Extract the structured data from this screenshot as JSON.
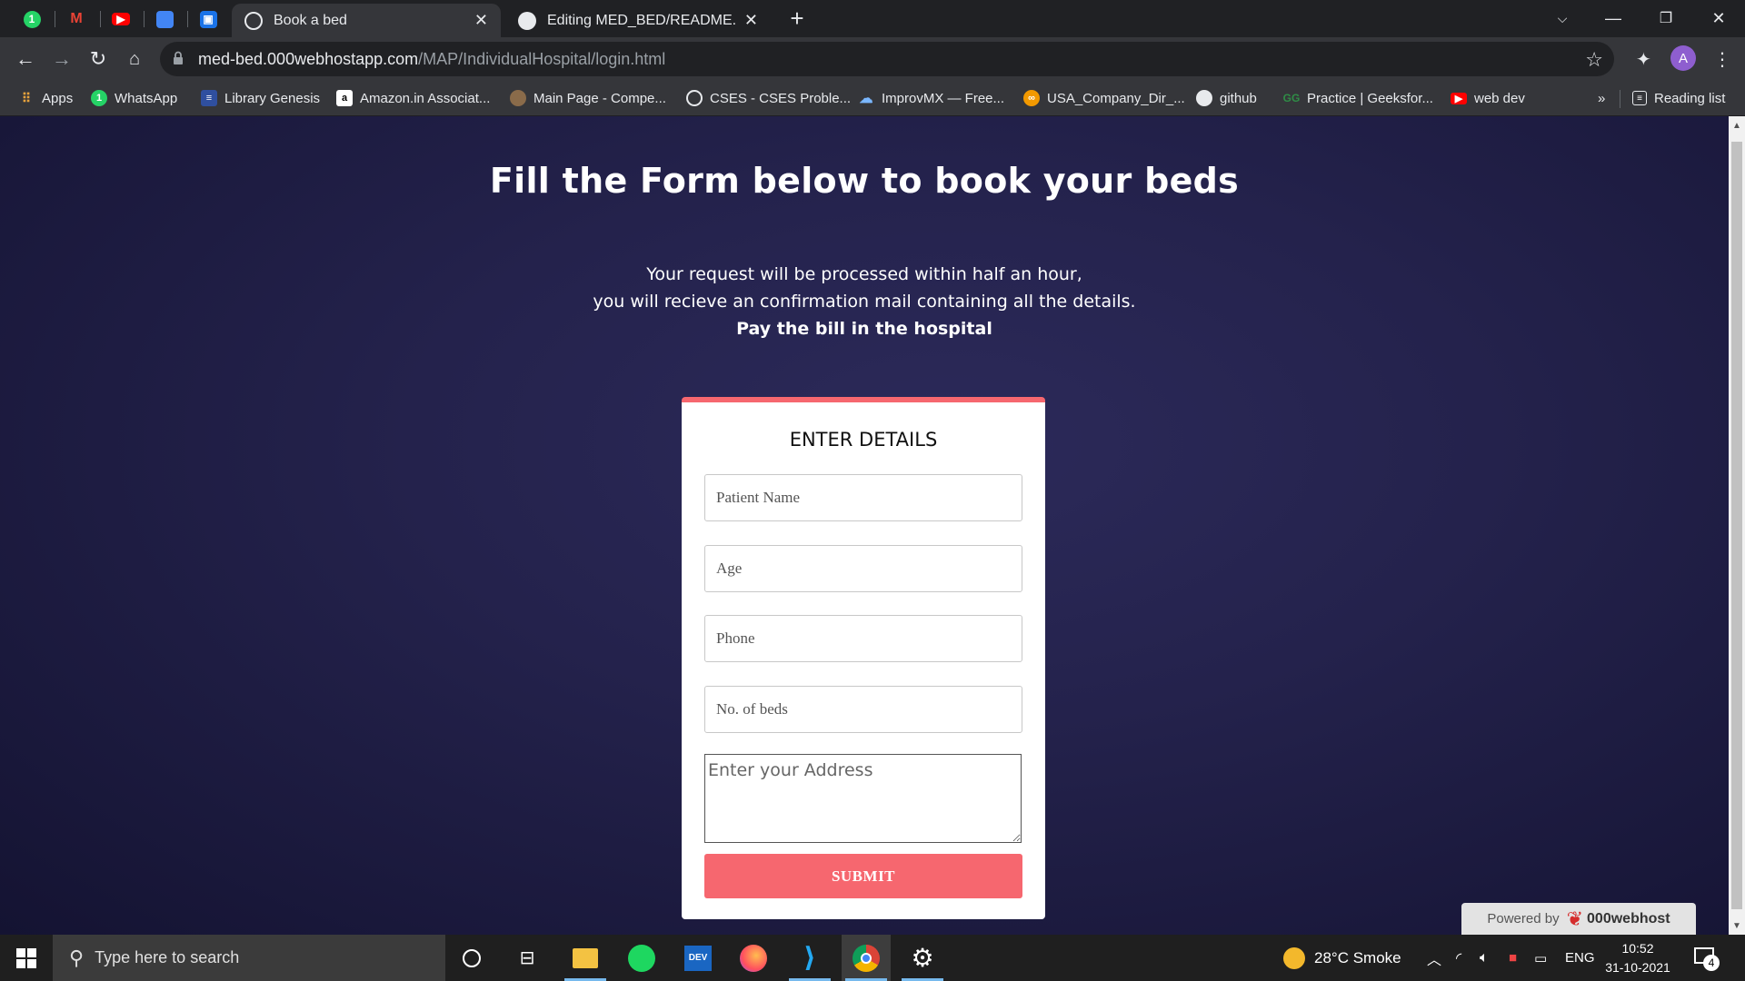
{
  "browser": {
    "tabs": [
      {
        "title": "Book a bed",
        "active": true
      },
      {
        "title": "Editing MED_BED/README.md at",
        "active": false
      }
    ],
    "url_domain": "med-bed.000webhostapp.com",
    "url_path": "/MAP/IndividualHospital/login.html",
    "profile_initial": "A",
    "bookmarks": [
      {
        "label": "Apps",
        "icon": "apps-grid-icon"
      },
      {
        "label": "WhatsApp",
        "icon": "whatsapp-icon"
      },
      {
        "label": "Library Genesis",
        "icon": "library-genesis-icon"
      },
      {
        "label": "Amazon.in Associat...",
        "icon": "amazon-icon"
      },
      {
        "label": "Main Page - Compe...",
        "icon": "competitive-programming-icon"
      },
      {
        "label": "CSES - CSES Proble...",
        "icon": "globe-icon"
      },
      {
        "label": "ImprovMX — Free...",
        "icon": "improvmx-icon"
      },
      {
        "label": "USA_Company_Dir_...",
        "icon": "company-dir-icon"
      },
      {
        "label": "github",
        "icon": "github-icon"
      },
      {
        "label": "Practice | Geeksfor...",
        "icon": "geeksforgeeks-icon"
      },
      {
        "label": "web dev",
        "icon": "youtube-icon"
      }
    ],
    "bookmarks_overflow": "»",
    "reading_list": "Reading list"
  },
  "page": {
    "heading": "Fill the Form below to book your beds",
    "sub_line1": "Your request will be processed within half an hour,",
    "sub_line2": "you will recieve an confirmation mail containing all the details.",
    "sub_line3": "Pay the bill in the hospital",
    "form": {
      "title": "ENTER DETAILS",
      "patient_name_placeholder": "Patient Name",
      "age_placeholder": "Age",
      "phone_placeholder": "Phone",
      "beds_placeholder": "No. of beds",
      "address_placeholder": "Enter your Address",
      "submit_label": "SUBMIT"
    },
    "powered_by": "Powered by",
    "powered_brand": "000webhost"
  },
  "taskbar": {
    "search_placeholder": "Type here to search",
    "weather": "28°C  Smoke",
    "language": "ENG",
    "time": "10:52",
    "date": "31-10-2021",
    "notification_count": "4"
  },
  "colors": {
    "accent": "#f6676f",
    "page_bg": "#24224c",
    "chrome_dark": "#202124",
    "chrome_toolbar": "#35363a"
  }
}
